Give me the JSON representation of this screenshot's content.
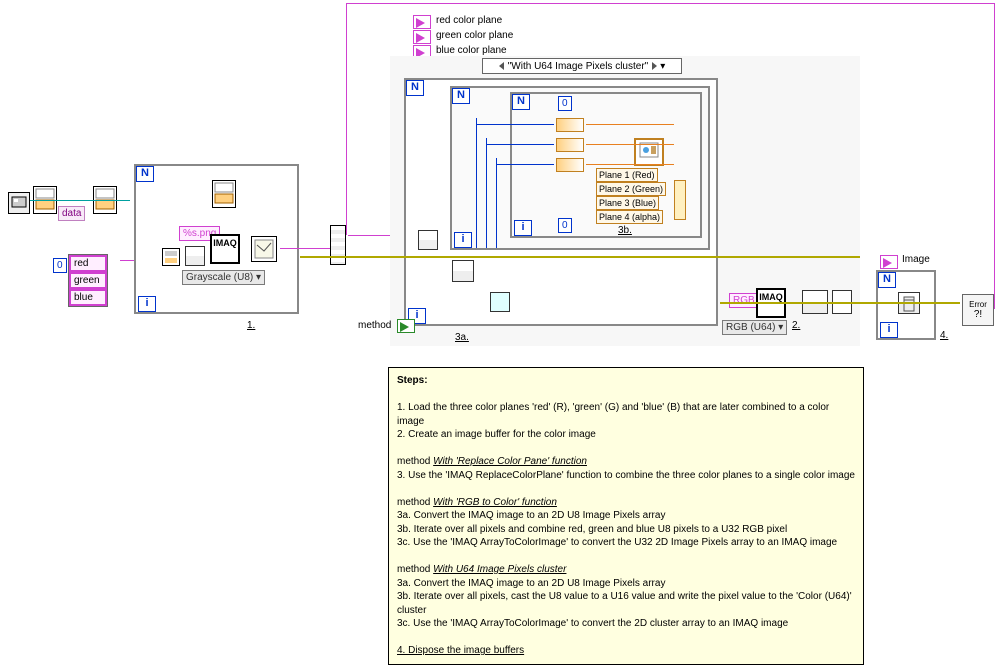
{
  "labels": {
    "red_plane": "red color plane",
    "green_plane": "green color plane",
    "blue_plane": "blue color plane",
    "data_local": "data",
    "fmt_string": "%s.png",
    "grayscale": "Grayscale (U8)",
    "method": "method",
    "rgb_const": "RGB",
    "rgb_u64": "RGB (U64)",
    "image_out": "Image",
    "plane1": "Plane 1 (Red)",
    "plane2": "Plane 2 (Green)",
    "plane3": "Plane 3 (Blue)",
    "plane4": "Plane 4 (alpha)",
    "case_name": "\"With U64 Image Pixels cluster\"",
    "zero": "0",
    "loop_n": "N",
    "loop_i": "i",
    "imaq": "IMAQ",
    "error": "Error",
    "colors": [
      "red",
      "green",
      "blue"
    ],
    "num1": "1.",
    "num2": "2.",
    "num3a": "3a.",
    "num3b": "3b.",
    "num4": "4."
  },
  "steps": {
    "title": "Steps:",
    "s1": "1. Load the three color planes 'red' (R), 'green' (G) and 'blue' (B) that are later combined to a color image",
    "s2": "2. Create an image buffer for the color image",
    "m1_head": "method  With 'Replace Color Pane' function",
    "m1_3": "3. Use the 'IMAQ ReplaceColorPlane' function to combine the three color planes to a single color image",
    "m2_head": "method  With 'RGB to Color' function",
    "m2_3a": "3a. Convert the IMAQ image to an 2D U8 Image Pixels array",
    "m2_3b": "3b. Iterate over all pixels and combine red, green and blue U8 pixels to a U32 RGB pixel",
    "m2_3c": "3c. Use the 'IMAQ ArrayToColorImage' to convert the U32 2D Image Pixels array to an IMAQ image",
    "m3_head": "method  With U64 Image Pixels cluster",
    "m3_3a": "3a. Convert the IMAQ image to an 2D U8 Image Pixels array",
    "m3_3b": "3b. Iterate over all pixels, cast the U8 value to a U16 value and write the pixel value to the 'Color (U64)' cluster",
    "m3_3c": "3c. Use the 'IMAQ ArrayToColorImage' to convert the 2D cluster array to an IMAQ image",
    "s4": "4. Dispose the image buffers"
  }
}
